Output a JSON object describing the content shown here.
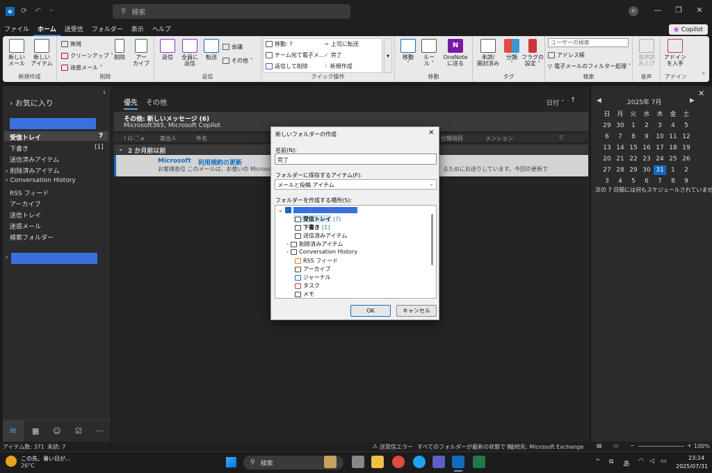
{
  "titlebar": {
    "search_placeholder": "検索",
    "win_controls": [
      "—",
      "❐",
      "✕"
    ]
  },
  "menu": {
    "items": [
      "ファイル",
      "ホーム",
      "送受信",
      "フォルダー",
      "表示",
      "ヘルプ"
    ],
    "copilot": "Copilot"
  },
  "ribbon": {
    "new": {
      "new_mail": "新しい\nメール",
      "new_item": "新しい\nアイテム",
      "label": "新規作成"
    },
    "delete": {
      "ignore": "無視",
      "cleanup": "クリーンアップ ˅",
      "junk": "迷惑メール ˅",
      "delete": "削除",
      "archive": "アー\nカイブ",
      "label": "削除"
    },
    "respond": {
      "reply": "返信",
      "reply_all": "全員に\n返信",
      "forward": "転送",
      "meeting": "会議",
      "more": "その他 ˅",
      "label": "返信"
    },
    "quicksteps": {
      "move_to": "移動: ?",
      "team_email": "チーム宛て電子メ...",
      "reply_delete": "返信して削除",
      "to_manager": "上司に転送",
      "done": "完了",
      "create_new": "新規作成",
      "label": "クイック操作"
    },
    "move": {
      "move": "移動\n˅",
      "rules": "ルー\nル ˅",
      "onenote": "OneNote\nに送る",
      "label": "移動"
    },
    "tags": {
      "unread": "未読/\n開封済み",
      "categorize": "分類\n˅",
      "followup": "フラグの\n設定 ˅",
      "label": "タグ"
    },
    "find": {
      "search_people": "ユーザーの検索",
      "address_book": "アドレス帳",
      "filter": "電子メールのフィルター処理 ˅",
      "label": "検索"
    },
    "speech": {
      "read_aloud": "音声読\nみ上げ",
      "label": "音声"
    },
    "addins": {
      "get_addins": "アドイン\nを入手",
      "label": "アドイン"
    }
  },
  "nav": {
    "favorites": "お気に入り",
    "inbox": "受信トレイ",
    "inbox_count": "7",
    "drafts": "下書き",
    "drafts_count": "[1]",
    "sent": "送信済みアイテム",
    "deleted": "削除済みアイテム",
    "conv": "Conversation History",
    "rss": "RSS フィード",
    "archive": "アーカイブ",
    "outbox": "送信トレイ",
    "junk": "迷惑メール",
    "search": "検索フォルダー"
  },
  "mail": {
    "tab_focused": "優先",
    "tab_other": "その他",
    "sort": "日付 ˅",
    "sort_arrow": "↑",
    "other_header": "その他: 新しいメッセージ (6)",
    "other_senders": "Microsoft365, Microsoft Copilot",
    "col_from": "差出人",
    "col_subject": "件名",
    "col_category": "分類項目",
    "col_mention": "メンション",
    "group": "2 か月前以前",
    "item_from": "Microsoft",
    "item_subject": "利用規約の更新",
    "item_preview": "お客様各位 このメールは、お使いの Microsoft 製",
    "item_preview2": "るためにお送りしています。今回の更新で"
  },
  "calendar": {
    "month": "2025年 7月",
    "weekdays": [
      "日",
      "月",
      "火",
      "水",
      "木",
      "金",
      "土"
    ],
    "weeks": [
      [
        "29",
        "30",
        "1",
        "2",
        "3",
        "4",
        "5"
      ],
      [
        "6",
        "7",
        "8",
        "9",
        "10",
        "11",
        "12"
      ],
      [
        "13",
        "14",
        "15",
        "16",
        "17",
        "18",
        "19"
      ],
      [
        "20",
        "21",
        "22",
        "23",
        "24",
        "25",
        "26"
      ],
      [
        "27",
        "28",
        "29",
        "30",
        "31",
        "1",
        "2"
      ],
      [
        "3",
        "4",
        "5",
        "6",
        "7",
        "8",
        "9"
      ]
    ],
    "today": "31",
    "note": "次の 7 日間には何もスケジュールされていません。"
  },
  "dialog": {
    "title": "新しいフォルダーの作成",
    "name_label": "名前(N):",
    "name_value": "完了",
    "type_label": "フォルダーに保存するアイテム(F):",
    "type_value": "メールと投稿 アイテム",
    "loc_label": "フォルダーを作成する場所(S):",
    "tree": {
      "inbox": "受信トレイ",
      "inbox_count": "(7)",
      "drafts": "下書き",
      "drafts_count": "[1]",
      "sent": "送信済みアイテム",
      "deleted": "削除済みアイテム",
      "conv": "Conversation History",
      "rss": "RSS フィード",
      "archive": "アーカイブ",
      "journal": "ジャーナル",
      "tasks": "タスク",
      "notes": "メモ"
    },
    "ok": "OK",
    "cancel": "キャンセル"
  },
  "status": {
    "items": "アイテム数: 371",
    "unread": "未読: 7",
    "error": "送受信エラー",
    "uptodate": "すべてのフォルダーが最新の状態です。",
    "connection": "接続先: Microsoft Exchange",
    "zoom": "100%"
  },
  "taskbar": {
    "weather": "この先、暑い日が...",
    "temp": "26°C",
    "search": "検索",
    "ime": "あ",
    "time": "23:24",
    "date": "2025/07/31"
  }
}
